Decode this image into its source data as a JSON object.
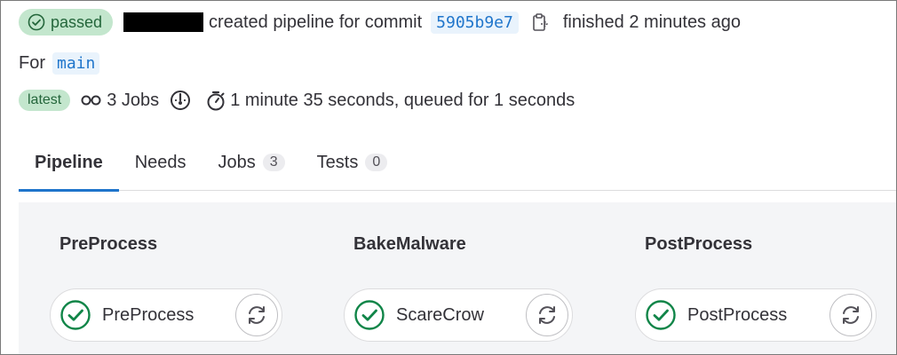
{
  "header": {
    "status_label": "passed",
    "created_text": "created pipeline for commit",
    "commit_sha": "5905b9e7",
    "finished_text": "finished 2 minutes ago"
  },
  "ref": {
    "prefix": "For",
    "branch": "main"
  },
  "meta": {
    "latest_label": "latest",
    "jobs_text": "3 Jobs",
    "duration_text": "1 minute 35 seconds, queued for 1 seconds"
  },
  "tabs": [
    {
      "label": "Pipeline",
      "count": null,
      "active": true
    },
    {
      "label": "Needs",
      "count": null,
      "active": false
    },
    {
      "label": "Jobs",
      "count": "3",
      "active": false
    },
    {
      "label": "Tests",
      "count": "0",
      "active": false
    }
  ],
  "stages": [
    {
      "title": "PreProcess",
      "job": "PreProcess",
      "status": "success"
    },
    {
      "title": "BakeMalware",
      "job": "ScareCrow",
      "status": "success"
    },
    {
      "title": "PostProcess",
      "job": "PostProcess",
      "status": "success"
    }
  ],
  "colors": {
    "success": "#108548",
    "link": "#1f75cb",
    "badge_bg": "#c3e6cd"
  },
  "icons": {
    "status": "check-circle-icon",
    "copy": "clipboard-icon",
    "jobs": "pipeline-jobs-icon",
    "duration": "stopwatch-icon",
    "retry": "retry-icon"
  }
}
